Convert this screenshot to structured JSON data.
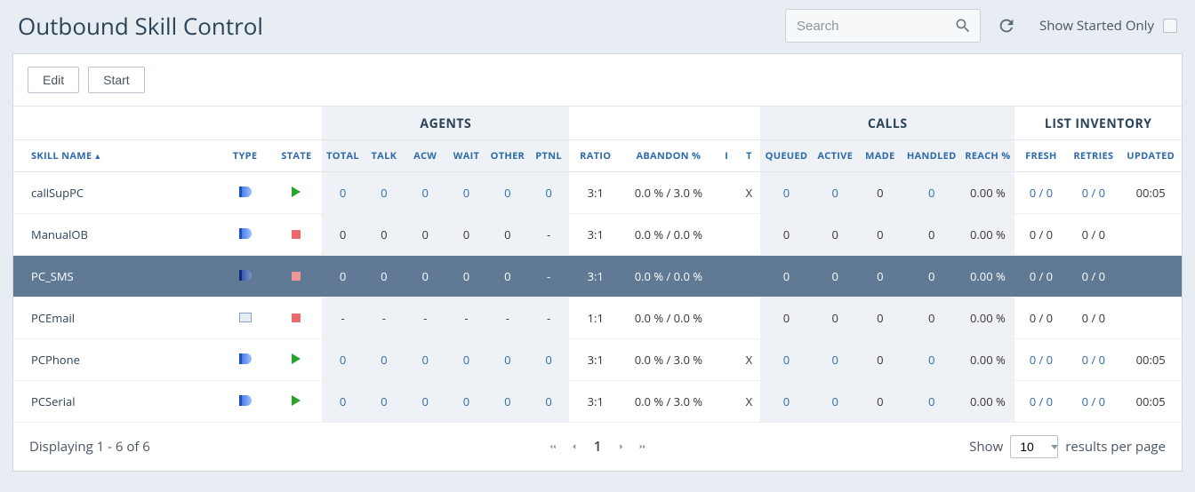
{
  "header": {
    "title": "Outbound Skill Control",
    "search_placeholder": "Search",
    "started_only_label": "Show Started Only"
  },
  "toolbar": {
    "edit_label": "Edit",
    "start_label": "Start"
  },
  "groups": {
    "agents": "AGENTS",
    "calls": "CALLS",
    "inventory": "LIST INVENTORY"
  },
  "columns": {
    "skill_name": "SKILL NAME",
    "type": "TYPE",
    "state": "STATE",
    "total": "TOTAL",
    "talk": "TALK",
    "acw": "ACW",
    "wait": "WAIT",
    "other": "OTHER",
    "ptnl": "PTNL",
    "ratio": "RATIO",
    "abandon": "ABANDON %",
    "i": "I",
    "t": "T",
    "queued": "QUEUED",
    "active": "ACTIVE",
    "made": "MADE",
    "handled": "HANDLED",
    "reach": "REACH %",
    "fresh": "FRESH",
    "retries": "RETRIES",
    "updated": "UPDATED"
  },
  "rows": [
    {
      "name": "callSupPC",
      "type": "phone",
      "state": "play",
      "total": "0",
      "talk": "0",
      "acw": "0",
      "wait": "0",
      "other": "0",
      "ptnl": "0",
      "ratio": "3:1",
      "abandon": "0.0 % / 3.0 %",
      "i": "",
      "t": "X",
      "queued": "0",
      "active": "0",
      "made": "0",
      "handled": "0",
      "reach": "0.00 %",
      "fresh": "0 / 0",
      "retries": "0 / 0",
      "updated": "00:05",
      "link": true
    },
    {
      "name": "ManualOB",
      "type": "phone",
      "state": "stop",
      "total": "0",
      "talk": "0",
      "acw": "0",
      "wait": "0",
      "other": "0",
      "ptnl": "-",
      "ratio": "3:1",
      "abandon": "0.0 % / 0.0 %",
      "i": "",
      "t": "",
      "queued": "0",
      "active": "0",
      "made": "0",
      "handled": "0",
      "reach": "0.00 %",
      "fresh": "0 / 0",
      "retries": "0 / 0",
      "updated": "",
      "link": false
    },
    {
      "name": "PC_SMS",
      "type": "phone",
      "state": "stop",
      "total": "0",
      "talk": "0",
      "acw": "0",
      "wait": "0",
      "other": "0",
      "ptnl": "-",
      "ratio": "3:1",
      "abandon": "0.0 % / 0.0 %",
      "i": "",
      "t": "",
      "queued": "0",
      "active": "0",
      "made": "0",
      "handled": "0",
      "reach": "0.00 %",
      "fresh": "0 / 0",
      "retries": "0 / 0",
      "updated": "",
      "link": false,
      "selected": true
    },
    {
      "name": "PCEmail",
      "type": "email",
      "state": "stop",
      "total": "-",
      "talk": "-",
      "acw": "-",
      "wait": "-",
      "other": "-",
      "ptnl": "-",
      "ratio": "1:1",
      "abandon": "0.0 % / 0.0 %",
      "i": "",
      "t": "",
      "queued": "0",
      "active": "0",
      "made": "0",
      "handled": "0",
      "reach": "0.00 %",
      "fresh": "0 / 0",
      "retries": "0 / 0",
      "updated": "",
      "link": false
    },
    {
      "name": "PCPhone",
      "type": "phone",
      "state": "play",
      "total": "0",
      "talk": "0",
      "acw": "0",
      "wait": "0",
      "other": "0",
      "ptnl": "0",
      "ratio": "3:1",
      "abandon": "0.0 % / 3.0 %",
      "i": "",
      "t": "X",
      "queued": "0",
      "active": "0",
      "made": "0",
      "handled": "0",
      "reach": "0.00 %",
      "fresh": "0 / 0",
      "retries": "0 / 0",
      "updated": "00:05",
      "link": true
    },
    {
      "name": "PCSerial",
      "type": "phone",
      "state": "play",
      "total": "0",
      "talk": "0",
      "acw": "0",
      "wait": "0",
      "other": "0",
      "ptnl": "0",
      "ratio": "3:1",
      "abandon": "0.0 % / 3.0 %",
      "i": "",
      "t": "X",
      "queued": "0",
      "active": "0",
      "made": "0",
      "handled": "0",
      "reach": "0.00 %",
      "fresh": "0 / 0",
      "retries": "0 / 0",
      "updated": "00:05",
      "link": true
    }
  ],
  "footer": {
    "displaying": "Displaying 1 - 6 of 6",
    "current_page": "1",
    "show_label": "Show",
    "results_label": "results per page",
    "page_size": "10"
  }
}
